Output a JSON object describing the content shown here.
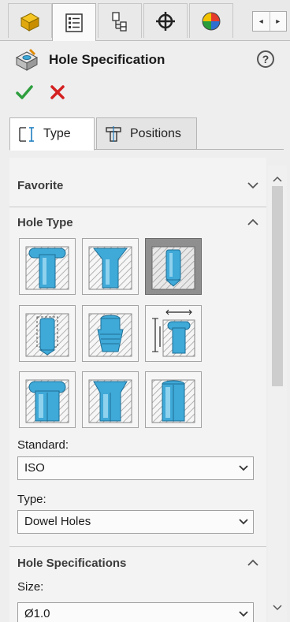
{
  "manager_tabs": {
    "icons": [
      "featuremanager-icon",
      "propertymanager-icon",
      "configurationmanager-icon",
      "dimxpertmanager-icon",
      "displaymanager-icon"
    ],
    "scroll_left": "◂",
    "scroll_right": "▸"
  },
  "header": {
    "title": "Hole Specification",
    "help": "?"
  },
  "sub_tabs": {
    "type_label": "Type",
    "positions_label": "Positions"
  },
  "sections": {
    "favorite": "Favorite",
    "hole_type": "Hole Type",
    "hole_specifications": "Hole Specifications"
  },
  "hole_types": [
    {
      "name": "counterbore",
      "selected": false
    },
    {
      "name": "countersink",
      "selected": false
    },
    {
      "name": "hole",
      "selected": true
    },
    {
      "name": "straight-tap",
      "selected": false
    },
    {
      "name": "tapered-tap",
      "selected": false
    },
    {
      "name": "legacy-hole",
      "selected": false
    },
    {
      "name": "counterbore-slot",
      "selected": false
    },
    {
      "name": "countersink-slot",
      "selected": false
    },
    {
      "name": "slot",
      "selected": false
    }
  ],
  "fields": {
    "standard_label": "Standard:",
    "standard_value": "ISO",
    "type_label": "Type:",
    "type_value": "Dowel Holes",
    "size_label": "Size:",
    "size_value": "Ø1.0"
  },
  "colors": {
    "accent_blue": "#3fa9d8",
    "ok_green": "#2e9e3e",
    "cancel_red": "#d42020"
  }
}
